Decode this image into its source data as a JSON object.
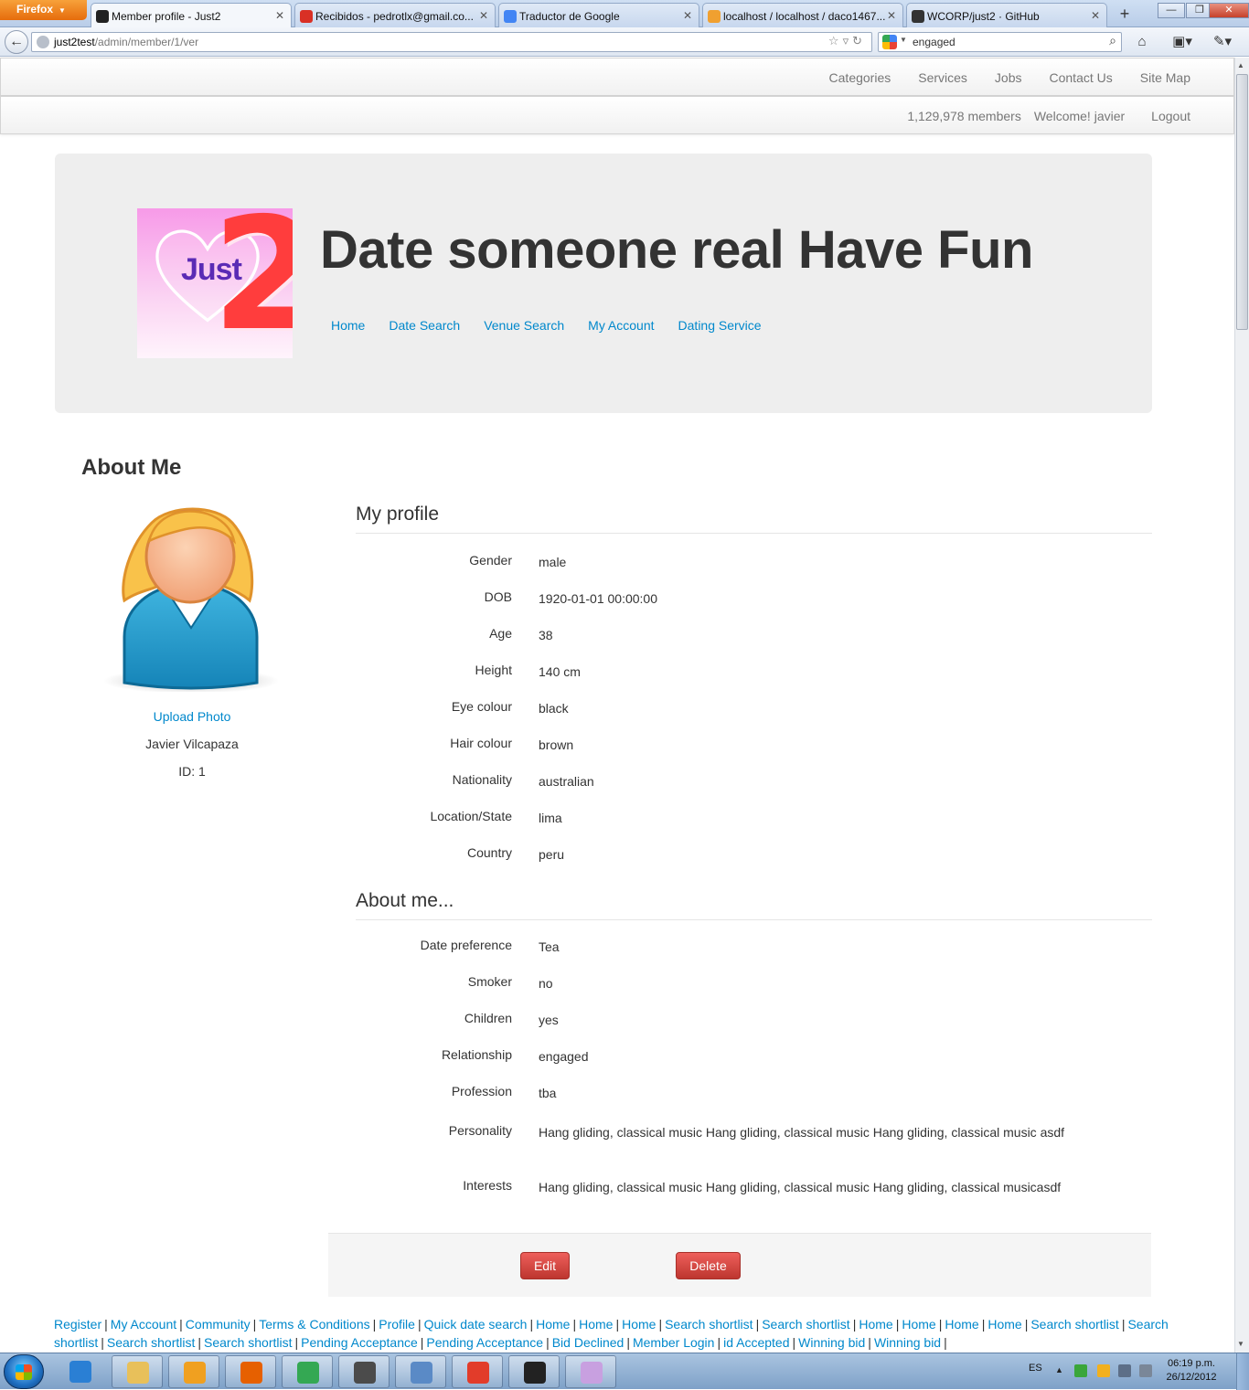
{
  "browser": {
    "menu_button": "Firefox",
    "tabs": [
      {
        "title": "Member profile - Just2",
        "favicon_color": "#222222",
        "active": true
      },
      {
        "title": "Recibidos - pedrotlx@gmail.co...",
        "favicon_color": "#d93025",
        "active": false
      },
      {
        "title": "Traductor de Google",
        "favicon_color": "#4285f4",
        "active": false
      },
      {
        "title": "localhost / localhost / daco1467...",
        "favicon_color": "#f0a030",
        "active": false
      },
      {
        "title": "WCORP/just2 · GitHub",
        "favicon_color": "#333333",
        "active": false
      }
    ],
    "url_host": "just2test",
    "url_path": "/admin/member/1/ver",
    "search_value": "engaged"
  },
  "topnav": {
    "items": [
      "Categories",
      "Services",
      "Jobs",
      "Contact Us",
      "Site Map"
    ]
  },
  "userbar": {
    "member_count": "1,129,978 members",
    "welcome": "Welcome! javier",
    "logout": "Logout"
  },
  "hero": {
    "logo_text": "Just",
    "logo_number": "2",
    "headline": "Date someone real Have Fun",
    "nav": [
      "Home",
      "Date Search",
      "Venue Search",
      "My Account",
      "Dating Service"
    ]
  },
  "about": {
    "title": "About Me",
    "upload_photo": "Upload Photo",
    "name": "Javier Vilcapaza",
    "id_label": "ID: 1"
  },
  "my_profile": {
    "heading": "My profile",
    "fields": [
      {
        "label": "Gender",
        "value": "male"
      },
      {
        "label": "DOB",
        "value": "1920-01-01 00:00:00"
      },
      {
        "label": "Age",
        "value": "38"
      },
      {
        "label": "Height",
        "value": "140 cm"
      },
      {
        "label": "Eye colour",
        "value": "black"
      },
      {
        "label": "Hair colour",
        "value": "brown"
      },
      {
        "label": "Nationality",
        "value": "australian"
      },
      {
        "label": "Location/State",
        "value": "lima"
      },
      {
        "label": "Country",
        "value": "peru"
      }
    ]
  },
  "about_me": {
    "heading": "About me...",
    "fields": [
      {
        "label": "Date preference",
        "value": "Tea"
      },
      {
        "label": "Smoker",
        "value": "no"
      },
      {
        "label": "Children",
        "value": "yes"
      },
      {
        "label": "Relationship",
        "value": "engaged"
      },
      {
        "label": "Profession",
        "value": "tba"
      },
      {
        "label": "Personality",
        "value": "Hang gliding, classical music Hang gliding, classical music Hang gliding, classical music asdf"
      },
      {
        "label": "Interests",
        "value": "Hang gliding, classical music Hang gliding, classical music Hang gliding, classical musicasdf"
      }
    ]
  },
  "actions": {
    "edit": "Edit",
    "delete": "Delete"
  },
  "footer_links": [
    "Register",
    "My Account",
    "Community",
    "Terms & Conditions",
    "Profile",
    "Quick date search",
    "Home",
    "Home",
    "Home",
    "Search shortlist",
    "Search shortlist",
    "Home",
    "Home",
    "Home",
    "Home",
    "Search shortlist",
    "Search shortlist",
    "Search shortlist",
    "Search shortlist",
    "Pending Acceptance",
    "Pending Acceptance",
    "Bid Declined",
    "Member Login",
    "id Accepted",
    "Winning bid",
    "Winning bid"
  ],
  "taskbar": {
    "apps": [
      {
        "name": "internet-explorer-icon",
        "color": "#2a7fd4"
      },
      {
        "name": "file-explorer-icon",
        "color": "#e8c05a"
      },
      {
        "name": "outlook-icon",
        "color": "#f0a020"
      },
      {
        "name": "firefox-icon",
        "color": "#e66000"
      },
      {
        "name": "chrome-icon",
        "color": "#34a853"
      },
      {
        "name": "sublime-text-icon",
        "color": "#4b4b4b"
      },
      {
        "name": "remote-desktop-icon",
        "color": "#5a8ac6"
      },
      {
        "name": "git-icon",
        "color": "#e23c2a"
      },
      {
        "name": "7zip-icon",
        "color": "#222222"
      },
      {
        "name": "paint-icon",
        "color": "#c8a0e0"
      }
    ],
    "language": "ES",
    "time": "06:19 p.m.",
    "date": "26/12/2012"
  }
}
